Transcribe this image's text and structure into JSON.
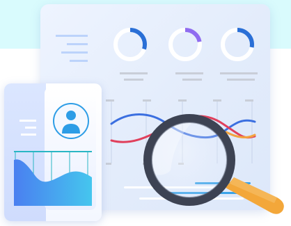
{
  "colors": {
    "background": "#ffffff",
    "cyan_band": "#d9fbfd",
    "panel": "#e6eefc",
    "placeholder_blue": "#bcd3fb",
    "placeholder_gray": "#c9ced8",
    "ring_blue": "#2a6fd6",
    "ring_light": "#9fd6f5",
    "ring_purple": "#8f6cf0",
    "wave_blue": "#3b6fe0",
    "wave_red": "#e0405c",
    "wave_orange": "#f2a340",
    "magnifier_rim": "#3d4353",
    "magnifier_handle": "#f3a73a",
    "area_fill_top": "#3aa8f0",
    "area_fill_bottom": "#57c9f2",
    "avatar": "#2d9de6"
  },
  "icons": {
    "avatar": "user-avatar-icon",
    "magnifier": "magnifying-glass-icon",
    "donut_1": "donut-chart-icon",
    "donut_2": "donut-chart-icon",
    "donut_3": "donut-chart-icon"
  },
  "illustration": {
    "donut_fractions": [
      0.3,
      0.22,
      0.28
    ]
  }
}
